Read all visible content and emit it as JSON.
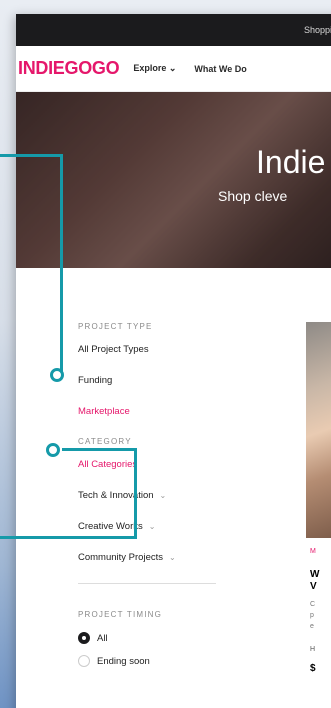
{
  "topbar": {
    "text": "Shopping"
  },
  "nav": {
    "logo": "INDIEGOGO",
    "explore": "Explore",
    "explore_chevron": "⌄",
    "what_we_do": "What We Do"
  },
  "hero": {
    "title": "Indie",
    "subtitle": "Shop cleve"
  },
  "filters": {
    "project_type_title": "PROJECT TYPE",
    "project_types": [
      "All Project Types",
      "Funding",
      "Marketplace"
    ],
    "category_title": "CATEGORY",
    "categories": [
      "All Categories",
      "Tech & Innovation",
      "Creative Works",
      "Community Projects"
    ],
    "chevron": "⌄",
    "timing_title": "PROJECT TIMING",
    "timing_options": [
      "All",
      "Ending soon"
    ]
  },
  "product": {
    "badge": "M",
    "title_line1": "W",
    "title_line2": "V",
    "desc_line1": "C",
    "desc_line2": "p",
    "desc_line3": "e",
    "raised_label": "H",
    "amount": "$"
  },
  "colors": {
    "brand": "#e5176b",
    "annotation": "#159aa9",
    "topbar": "#1b1b1d"
  }
}
